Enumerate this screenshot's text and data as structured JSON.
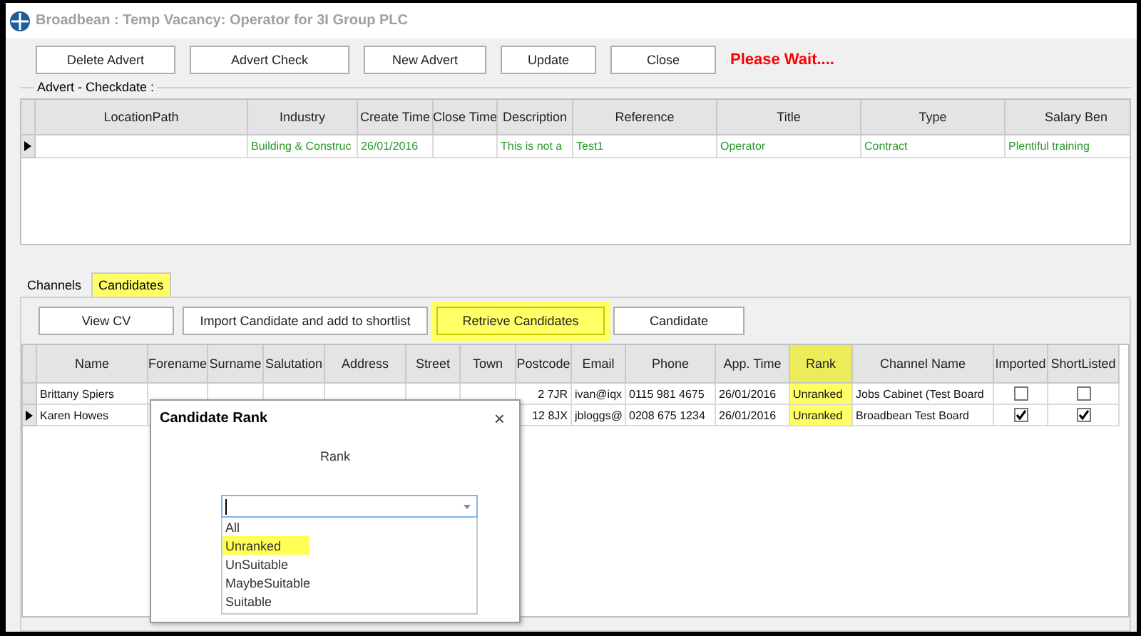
{
  "window": {
    "title": "Broadbean : Temp Vacancy: Operator for 3I Group PLC"
  },
  "toolbar": {
    "buttons": [
      "Delete Advert",
      "Advert Check",
      "New Advert",
      "Update",
      "Close"
    ],
    "status": "Please Wait...."
  },
  "advert_group": {
    "label": "Advert - Checkdate :",
    "columns": [
      "LocationPath",
      "Industry",
      "Create Time",
      "Close Time",
      "Description",
      "Reference",
      "Title",
      "Type",
      "Salary Ben"
    ],
    "rows": [
      {
        "current": true,
        "cells": [
          "",
          "Building & Construc",
          "26/01/2016",
          "",
          "This is not a",
          "Test1",
          "Operator",
          "Contract",
          "Plentiful training"
        ]
      }
    ]
  },
  "tabs": [
    {
      "label": "Channels",
      "selected": false,
      "highlighted": false
    },
    {
      "label": "Candidates",
      "selected": true,
      "highlighted": true
    }
  ],
  "candidate_buttons": [
    {
      "label": "View CV",
      "highlighted": false
    },
    {
      "label": "Import Candidate and add to shortlist",
      "highlighted": false
    },
    {
      "label": "Retrieve Candidates",
      "highlighted": true
    },
    {
      "label": "Candidate",
      "highlighted": false
    }
  ],
  "candidates": {
    "columns": [
      {
        "label": "Name",
        "highlighted": false
      },
      {
        "label": "Forename",
        "highlighted": false
      },
      {
        "label": "Surname",
        "highlighted": false
      },
      {
        "label": "Salutation",
        "highlighted": false
      },
      {
        "label": "Address",
        "highlighted": false
      },
      {
        "label": "Street",
        "highlighted": false
      },
      {
        "label": "Town",
        "highlighted": false
      },
      {
        "label": "Postcode",
        "highlighted": false
      },
      {
        "label": "Email",
        "highlighted": false
      },
      {
        "label": "Phone",
        "highlighted": false
      },
      {
        "label": "App. Time",
        "highlighted": false
      },
      {
        "label": "Rank",
        "highlighted": true
      },
      {
        "label": "Channel Name",
        "highlighted": false
      },
      {
        "label": "Imported",
        "highlighted": false
      },
      {
        "label": "ShortListed",
        "highlighted": false
      }
    ],
    "rows": [
      {
        "current": false,
        "cells": [
          "Brittany Spiers",
          "",
          "",
          "",
          "",
          "",
          "",
          "2 7JR",
          "ivan@iqx",
          "0115 981 4675",
          "26/01/2016",
          "Unranked",
          "Jobs Cabinet (Test Board"
        ],
        "imported": false,
        "shortlisted": false
      },
      {
        "current": true,
        "cells": [
          "Karen Howes",
          "",
          "",
          "",
          "",
          "",
          "",
          "12 8JX",
          "jbloggs@",
          "0208 675 1234",
          "26/01/2016",
          "Unranked",
          "Broadbean Test Board"
        ],
        "imported": true,
        "shortlisted": true
      }
    ]
  },
  "dialog": {
    "title": "Candidate Rank",
    "close": "×",
    "label": "Rank",
    "combo": {
      "options": [
        {
          "label": "All",
          "highlighted": false
        },
        {
          "label": "Unranked",
          "highlighted": true
        },
        {
          "label": "UnSuitable",
          "highlighted": false
        },
        {
          "label": "MaybeSuitable",
          "highlighted": false
        },
        {
          "label": "Suitable",
          "highlighted": false
        }
      ]
    }
  }
}
